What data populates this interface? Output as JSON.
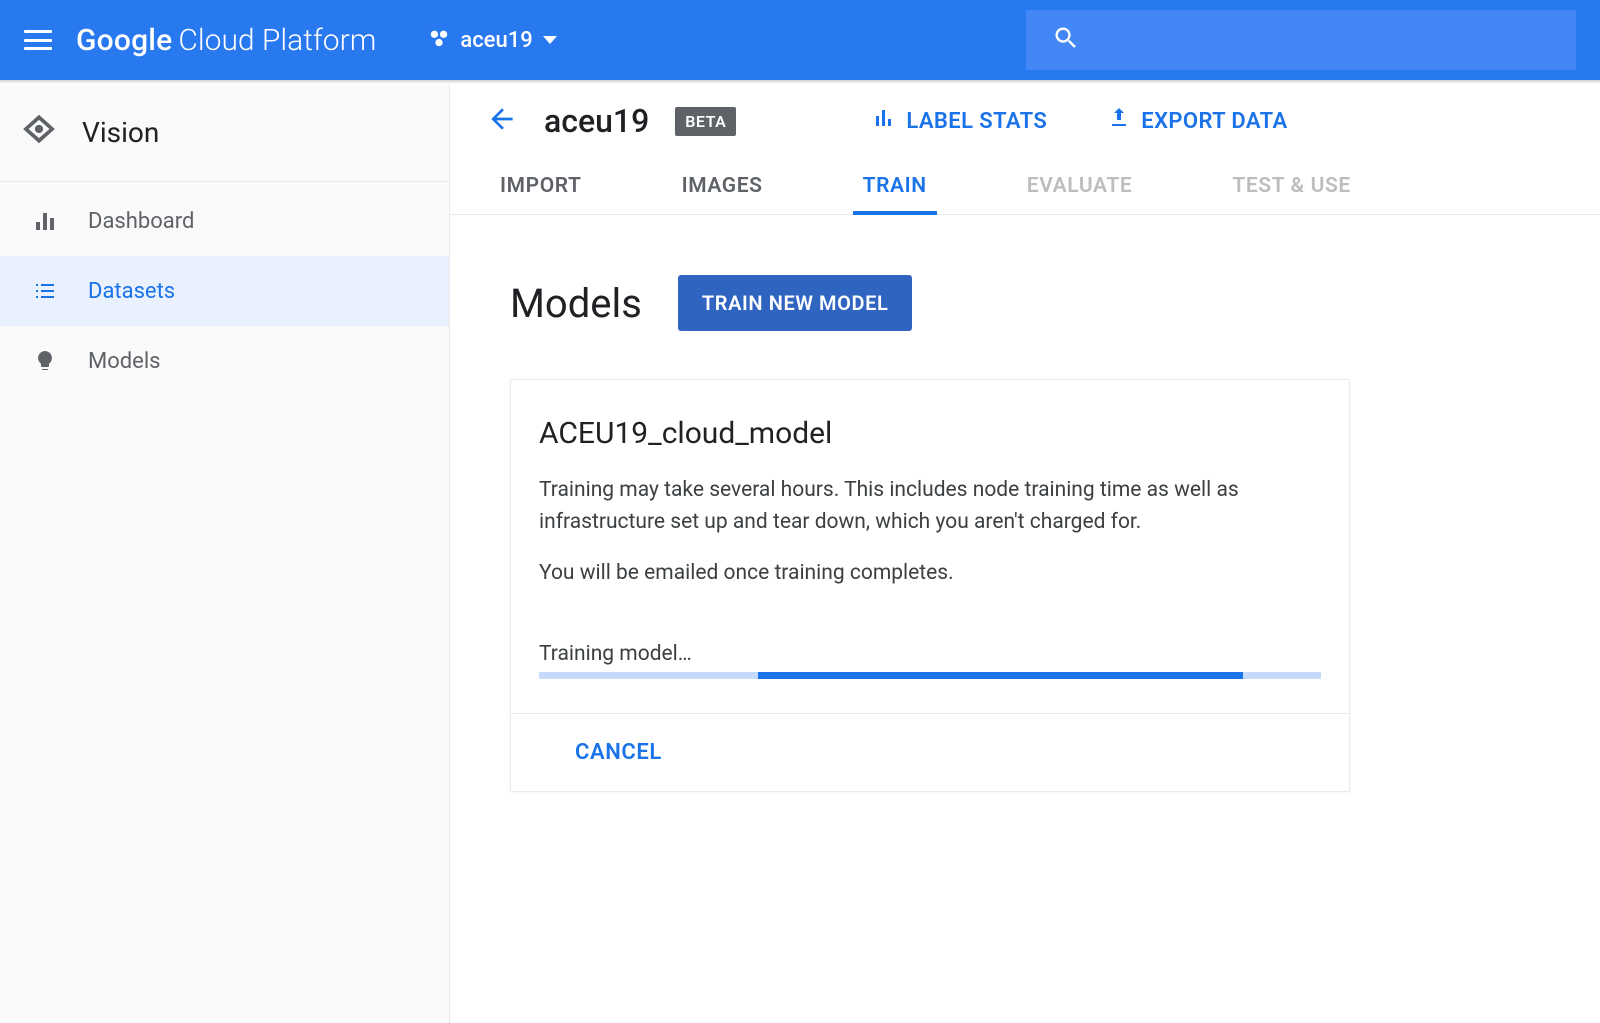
{
  "header": {
    "platform_google": "Google",
    "platform_rest": "Cloud Platform",
    "project_name": "aceu19"
  },
  "sidebar": {
    "product": "Vision",
    "items": [
      {
        "label": "Dashboard"
      },
      {
        "label": "Datasets"
      },
      {
        "label": "Models"
      }
    ]
  },
  "page": {
    "dataset_name": "aceu19",
    "badge": "BETA",
    "actions": {
      "label_stats": "LABEL STATS",
      "export": "EXPORT DATA"
    },
    "tabs": {
      "import": "IMPORT",
      "images": "IMAGES",
      "train": "TRAIN",
      "evaluate": "EVALUATE",
      "test_use": "TEST & USE"
    },
    "models_heading": "Models",
    "train_new_model": "TRAIN NEW MODEL"
  },
  "card": {
    "model_name": "ACEU19_cloud_model",
    "desc1": "Training may take several hours. This includes node training time as well as infrastructure set up and tear down, which you aren't charged for.",
    "desc2": "You will be emailed once training completes.",
    "progress_label": "Training model…",
    "cancel": "CANCEL"
  }
}
